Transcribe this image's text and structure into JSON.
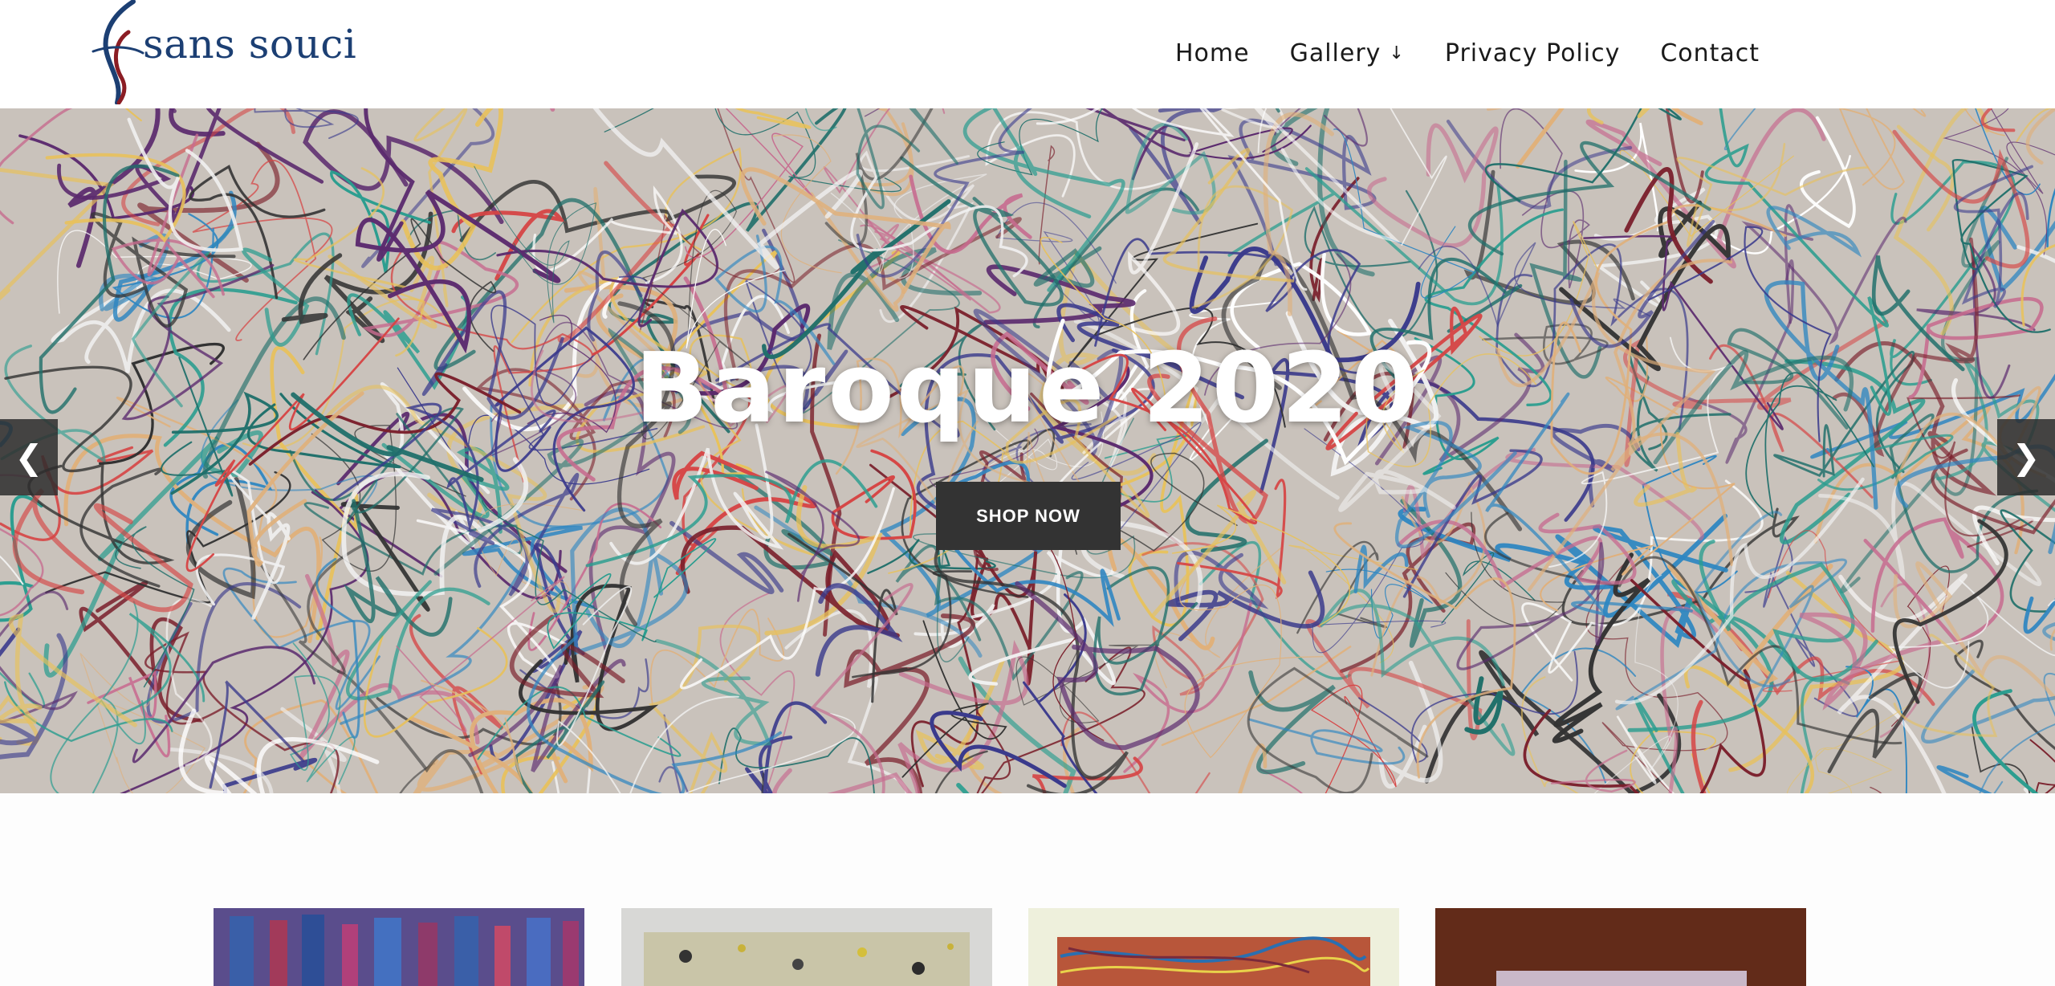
{
  "site": {
    "logo_text": "sans souci"
  },
  "nav": {
    "items": [
      {
        "label": "Home"
      },
      {
        "label": "Gallery",
        "icon": "arrow-down-icon",
        "arrow": "↓"
      },
      {
        "label": "Privacy Policy"
      },
      {
        "label": "Contact"
      }
    ]
  },
  "hero": {
    "title": "Baroque 2020",
    "button_label": "SHOP NOW",
    "prev_arrow": "❮",
    "next_arrow": "❯"
  },
  "products": {
    "thumbnails": [
      {
        "icon": "painting-thumbnail"
      },
      {
        "icon": "painting-thumbnail"
      },
      {
        "icon": "painting-thumbnail"
      },
      {
        "icon": "painting-thumbnail"
      }
    ]
  },
  "colors": {
    "logo_blue": "#1c3f73",
    "logo_red": "#8b1d24",
    "button_bg": "#333333",
    "arrow_bg": "#2d2d2d"
  }
}
